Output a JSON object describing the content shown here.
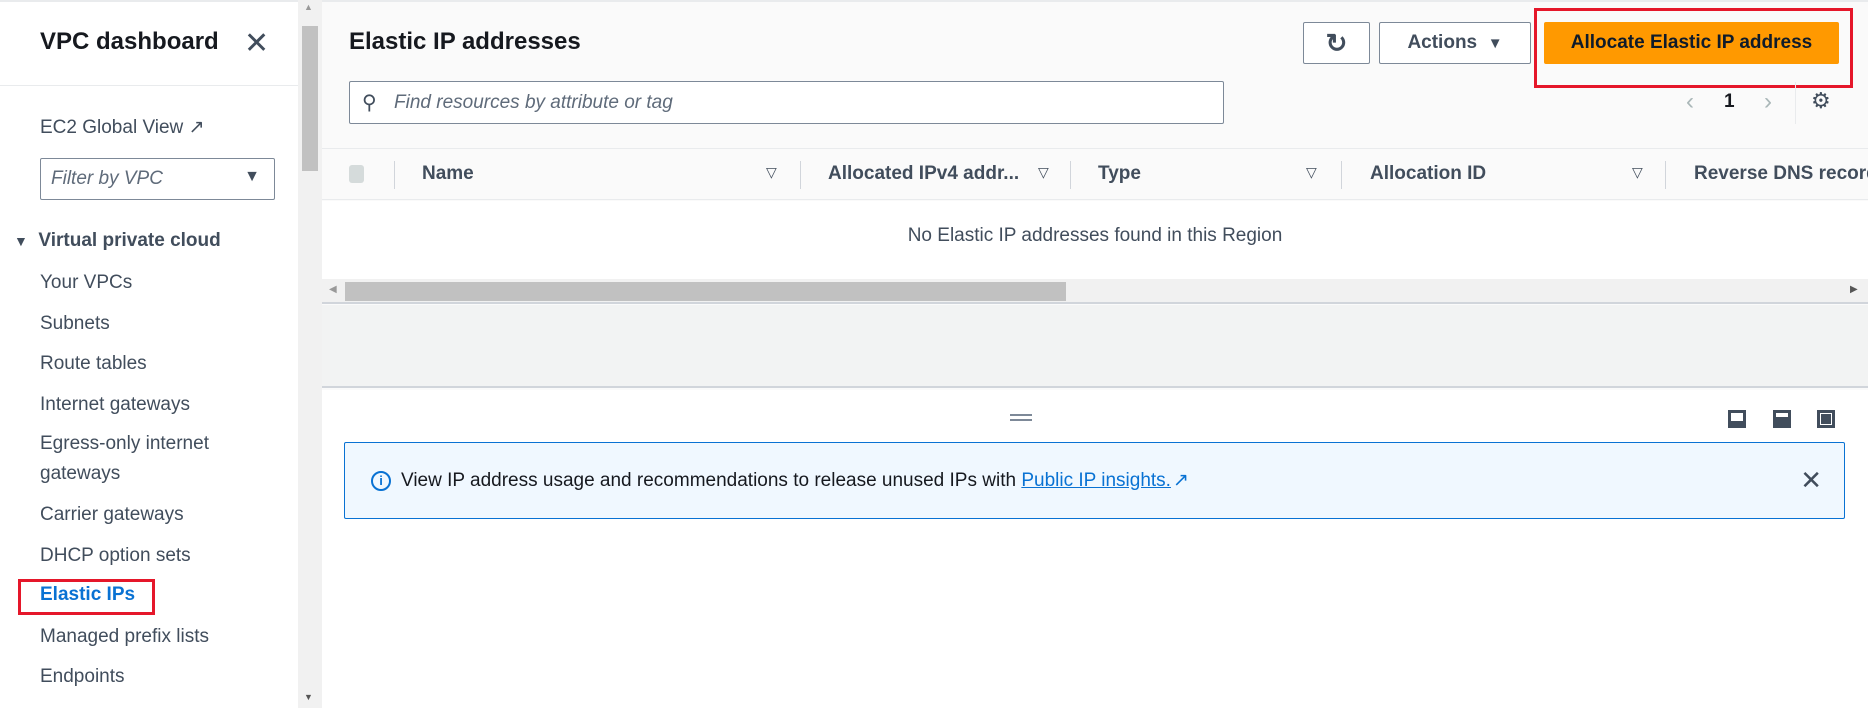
{
  "sidebar": {
    "title": "VPC dashboard",
    "ec2_global_view": "EC2 Global View",
    "filter_placeholder": "Filter by VPC",
    "section": "Virtual private cloud",
    "items": [
      "Your VPCs",
      "Subnets",
      "Route tables",
      "Internet gateways",
      "Egress-only internet",
      "gateways",
      "Carrier gateways",
      "DHCP option sets",
      "Elastic IPs",
      "Managed prefix lists",
      "Endpoints"
    ]
  },
  "main": {
    "title": "Elastic IP addresses",
    "actions_label": "Actions",
    "allocate_label": "Allocate Elastic IP address",
    "search_placeholder": "Find resources by attribute or tag",
    "page": "1",
    "columns": [
      "Name",
      "Allocated IPv4 addr...",
      "Type",
      "Allocation ID",
      "Reverse DNS record"
    ],
    "empty_text": "No Elastic IP addresses found in this Region",
    "info_text": "View IP address usage and recommendations to release unused IPs with ",
    "info_link": "Public IP insights."
  },
  "colors": {
    "accent": "#0972d3",
    "primary": "#ff9900",
    "highlight": "#e5172a"
  }
}
